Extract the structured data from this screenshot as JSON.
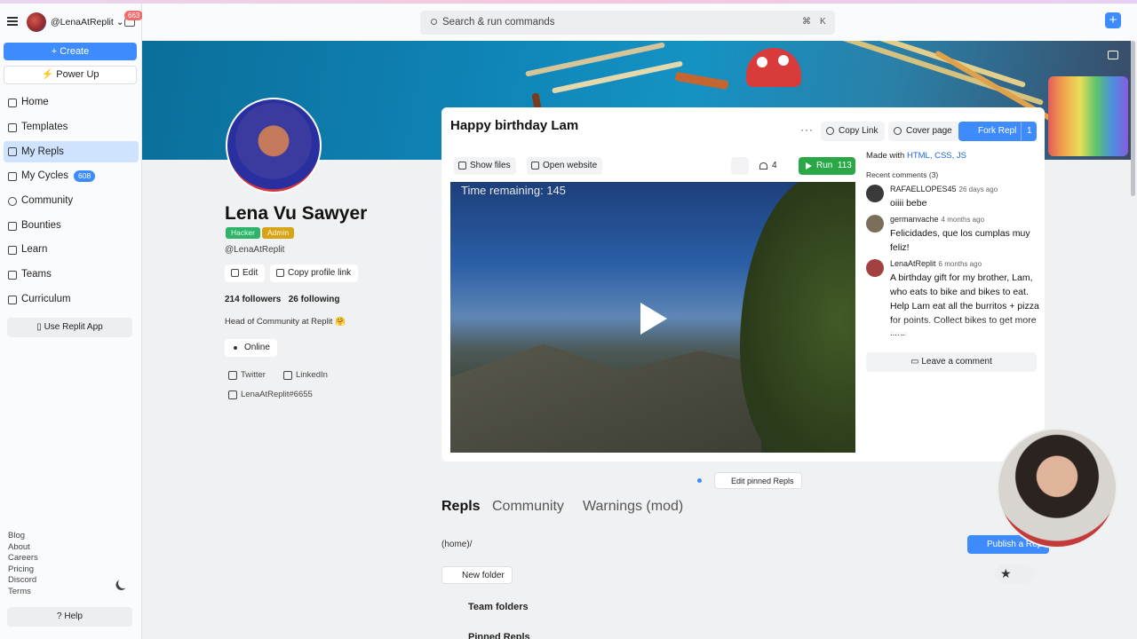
{
  "user": {
    "handle": "@LenaAtReplit",
    "notifications": "663"
  },
  "sidebar": {
    "create_label": "Create",
    "powerup_label": "Power Up",
    "nav": [
      {
        "label": "Home",
        "icon": "home-icon"
      },
      {
        "label": "Templates",
        "icon": "templates-icon"
      },
      {
        "label": "My Repls",
        "icon": "repls-icon",
        "active": true
      },
      {
        "label": "My Cycles",
        "icon": "cycles-icon",
        "badge": "608"
      },
      {
        "label": "Community",
        "icon": "globe-icon"
      },
      {
        "label": "Bounties",
        "icon": "bounties-icon"
      },
      {
        "label": "Learn",
        "icon": "learn-icon"
      },
      {
        "label": "Teams",
        "icon": "teams-icon"
      },
      {
        "label": "Curriculum",
        "icon": "curriculum-icon"
      }
    ],
    "use_app_label": "Use Replit App",
    "footer_links": [
      "Blog",
      "About",
      "Careers",
      "Pricing",
      "Discord",
      "Terms"
    ],
    "help_label": "Help"
  },
  "topbar": {
    "search_placeholder": "Search & run commands",
    "shortcut_cmd": "⌘",
    "shortcut_key": "K"
  },
  "profile": {
    "name": "Lena Vu Sawyer",
    "badges": [
      "Hacker",
      "Admin"
    ],
    "handle": "@LenaAtReplit",
    "edit_label": "Edit",
    "copy_link_label": "Copy profile link",
    "followers": "214 followers",
    "following": "26 following",
    "bio": "Head of Community at Replit 🤗",
    "status": "Online",
    "twitter": "Twitter",
    "linkedin": "LinkedIn",
    "discord": "LenaAtReplit#6655"
  },
  "featured": {
    "title": "Happy birthday Lam",
    "copy_link": "Copy Link",
    "cover_page": "Cover page",
    "fork_label": "Fork Repl",
    "fork_count": "1",
    "show_files": "Show files",
    "open_website": "Open website",
    "likes": "4",
    "run_label": "Run",
    "run_count": "113",
    "game_text": "Time remaining: 145",
    "made_with_prefix": "Made with",
    "made_with_langs": "HTML, CSS, JS",
    "recent_comments": "Recent comments (3)",
    "comments": [
      {
        "author": "RAFAELLOPES45",
        "time": "26 days ago",
        "text": "oiiii bebe"
      },
      {
        "author": "germanvache",
        "time": "4 months ago",
        "text": "Felicidades, que los cumplas muy feliz!"
      },
      {
        "author": "LenaAtReplit",
        "time": "6 months ago",
        "text": "A birthday gift for my brother, Lam, who eats to bike and bikes to eat. Help Lam eat all the burritos + pizza for points. Collect bikes to get more time."
      }
    ],
    "leave_comment": "Leave a comment"
  },
  "pinned": {
    "edit_label": "Edit pinned Repls"
  },
  "tabs": [
    "Repls",
    "Community",
    "Warnings (mod)"
  ],
  "repls": {
    "path": "(home)/",
    "publish_label": "Publish a Repl",
    "new_folder": "New folder",
    "team_folders": "Team folders",
    "pinned_repls": "Pinned Repls"
  },
  "colors": {
    "accent": "#3d8bfd",
    "run_green": "#2aa847",
    "hacker_green": "#2fb36a",
    "admin_gold": "#d6a419"
  }
}
